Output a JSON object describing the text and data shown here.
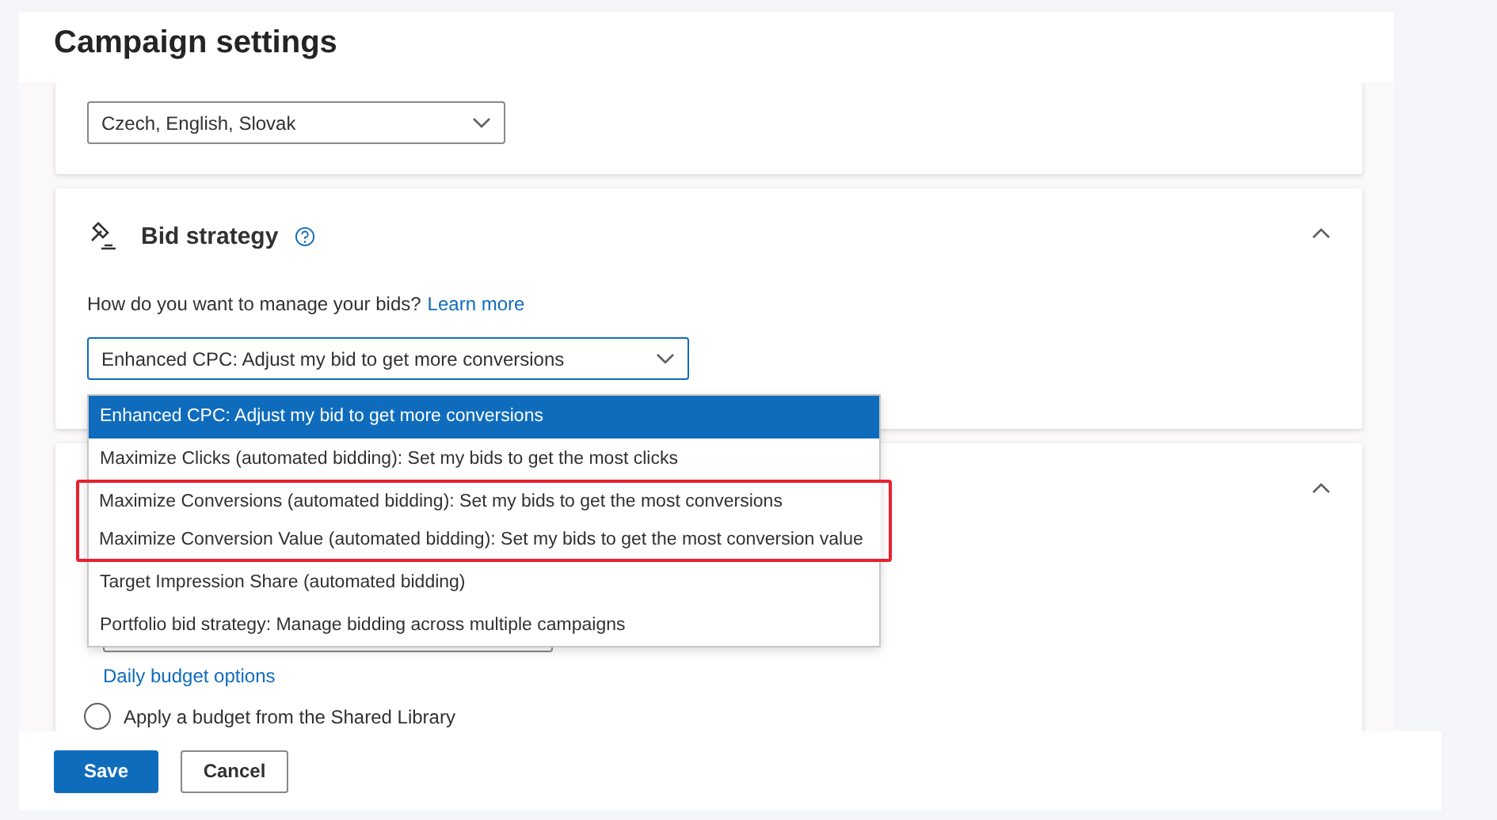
{
  "title": "Campaign settings",
  "language": {
    "value": "Czech, English, Slovak"
  },
  "bid_strategy": {
    "title": "Bid strategy",
    "expanded": true,
    "question": "How do you want to manage your bids?",
    "link": "Learn more",
    "value": "Enhanced CPC: Adjust my bid to get more conversions",
    "options": [
      {
        "label": "Enhanced CPC: Adjust my bid to get more conversions",
        "selected": true,
        "highlighted": false
      },
      {
        "label": "Maximize Clicks (automated bidding): Set my bids to get the most clicks",
        "selected": false,
        "highlighted": false
      },
      {
        "label": "Maximize Conversions (automated bidding): Set my bids to get the most conversions",
        "selected": false,
        "highlighted": true
      },
      {
        "label": "Maximize Conversion Value (automated bidding): Set my bids to get the most conversion value",
        "selected": false,
        "highlighted": true
      },
      {
        "label": "Target Impression Share (automated bidding)",
        "selected": false,
        "highlighted": false
      },
      {
        "label": "Portfolio bid strategy: Manage bidding across multiple campaigns",
        "selected": false,
        "highlighted": false
      }
    ]
  },
  "budget": {
    "expanded": true,
    "link": "Daily budget options",
    "radio_label": "Apply a budget from the Shared Library",
    "radio_selected": false
  },
  "buttons": [
    {
      "label": "Save",
      "kind": "primary"
    },
    {
      "label": "Cancel",
      "kind": "secondary"
    }
  ]
}
